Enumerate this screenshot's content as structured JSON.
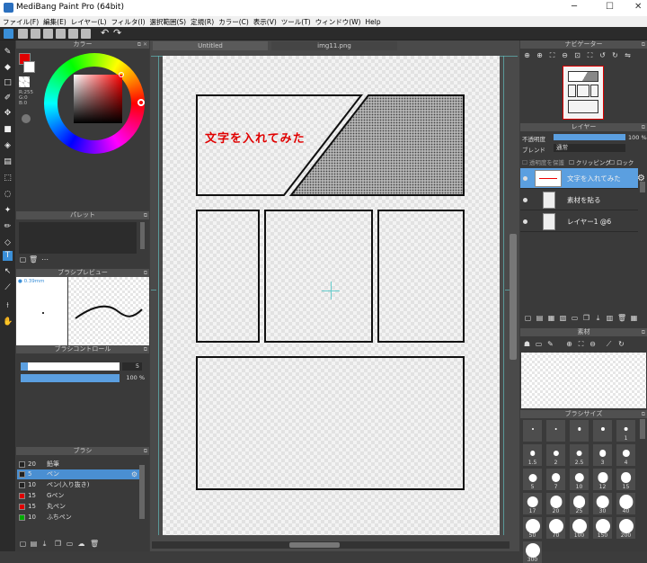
{
  "window": {
    "title": "MediBang Paint Pro (64bit)",
    "minimize": "─",
    "maximize": "☐",
    "close": "✕"
  },
  "menu": [
    "ファイル(F)",
    "編集(E)",
    "レイヤー(L)",
    "フィルタ(I)",
    "選択範囲(S)",
    "定規(R)",
    "カラー(C)",
    "表示(V)",
    "ツール(T)",
    "ウィンドウ(W)",
    "Help"
  ],
  "tabs": {
    "active": "Untitled",
    "second": "img11.png"
  },
  "panels": {
    "color": "カラー",
    "palette": "パレット",
    "brush_preview": "ブラシプレビュー",
    "brush_control": "ブラシコントロール",
    "brush": "ブラシ",
    "navigator": "ナビゲーター",
    "layer": "レイヤー",
    "material": "素材",
    "brush_size": "ブラシサイズ"
  },
  "color": {
    "rgb": "R:255\nG:0\nB:0",
    "primary": "#e00000",
    "secondary": "#ffffff"
  },
  "brush_preview": {
    "size": "0.39mm"
  },
  "brush_control": {
    "size_value": "5",
    "opacity_value": "100 %",
    "size_fraction": 0.07,
    "opacity_fraction": 1.0
  },
  "brushes": [
    {
      "num": "20",
      "label": "鉛筆",
      "color": "#222222",
      "selected": false
    },
    {
      "num": "5",
      "label": "ペン",
      "color": "#222222",
      "selected": true
    },
    {
      "num": "10",
      "label": "ペン(入り抜き)",
      "color": "#222222",
      "selected": false
    },
    {
      "num": "15",
      "label": "Gペン",
      "color": "#e00000",
      "selected": false
    },
    {
      "num": "15",
      "label": "丸ペン",
      "color": "#e00000",
      "selected": false
    },
    {
      "num": "10",
      "label": "ふちペン",
      "color": "#00aa00",
      "selected": false
    }
  ],
  "layer_panel": {
    "opacity_label": "不透明度",
    "opacity_value": "100 %",
    "blend_label": "ブレンド",
    "blend_value": "通常",
    "protect": "透明度を保護",
    "clipping": "クリッピング",
    "lock": "ロック",
    "opacity_fraction": 1.0
  },
  "layers": [
    {
      "name": "文字を入れてみた",
      "selected": true
    },
    {
      "name": "素材を貼る",
      "selected": false
    },
    {
      "name": "レイヤー1 @6",
      "selected": false
    }
  ],
  "canvas": {
    "text": "文字を入れてみた",
    "text_color": "#e00000"
  },
  "brush_sizes": [
    "",
    "",
    "",
    "",
    "1",
    "1.5",
    "2",
    "2.5",
    "3",
    "4",
    "5",
    "7",
    "10",
    "12",
    "15",
    "17",
    "20",
    "25",
    "30",
    "40",
    "50",
    "70",
    "100",
    "150",
    "200",
    "300"
  ]
}
